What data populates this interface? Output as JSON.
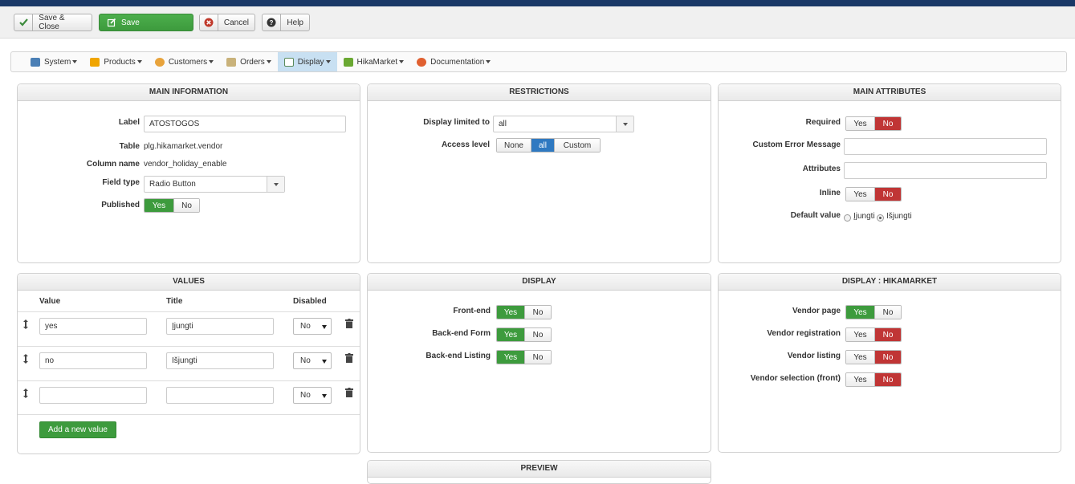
{
  "toolbar": {
    "save_close": "Save & Close",
    "save": "Save",
    "cancel": "Cancel",
    "help": "Help"
  },
  "menu": [
    {
      "label": "System",
      "icon": "wrench-icon"
    },
    {
      "label": "Products",
      "icon": "products-icon"
    },
    {
      "label": "Customers",
      "icon": "customers-icon"
    },
    {
      "label": "Orders",
      "icon": "orders-icon"
    },
    {
      "label": "Display",
      "icon": "display-icon",
      "active": true
    },
    {
      "label": "HikaMarket",
      "icon": "hikamarket-icon"
    },
    {
      "label": "Documentation",
      "icon": "lifebuoy-icon"
    }
  ],
  "main_info": {
    "title": "MAIN INFORMATION",
    "label_label": "Label",
    "label_value": "ATOSTOGOS",
    "table_label": "Table",
    "table_value": "plg.hikamarket.vendor",
    "column_label": "Column name",
    "column_value": "vendor_holiday_enable",
    "fieldtype_label": "Field type",
    "fieldtype_value": "Radio Button",
    "published_label": "Published",
    "yes": "Yes",
    "no": "No"
  },
  "restrictions": {
    "title": "RESTRICTIONS",
    "display_limited_label": "Display limited to",
    "display_limited_value": "all",
    "access_label": "Access level",
    "access_none": "None",
    "access_all": "all",
    "access_custom": "Custom"
  },
  "main_attributes": {
    "title": "MAIN ATTRIBUTES",
    "required_label": "Required",
    "custom_error_label": "Custom Error Message",
    "attributes_label": "Attributes",
    "inline_label": "Inline",
    "default_label": "Default value",
    "default_opt1": "Įjungti",
    "default_opt2": "Išjungti",
    "yes": "Yes",
    "no": "No"
  },
  "values": {
    "title": "VALUES",
    "col_value": "Value",
    "col_title": "Title",
    "col_disabled": "Disabled",
    "rows": [
      {
        "value": "yes",
        "title": "Įjungti",
        "disabled": "No"
      },
      {
        "value": "no",
        "title": "Išjungti",
        "disabled": "No"
      },
      {
        "value": "",
        "title": "",
        "disabled": "No"
      }
    ],
    "add_button": "Add a new value"
  },
  "display": {
    "title": "DISPLAY",
    "frontend_label": "Front-end",
    "backend_form_label": "Back-end Form",
    "backend_listing_label": "Back-end Listing",
    "yes": "Yes",
    "no": "No"
  },
  "display_hika": {
    "title": "DISPLAY : HIKAMARKET",
    "vendor_page_label": "Vendor page",
    "vendor_registration_label": "Vendor registration",
    "vendor_listing_label": "Vendor listing",
    "vendor_selection_label": "Vendor selection (front)",
    "yes": "Yes",
    "no": "No"
  },
  "preview": {
    "title": "PREVIEW"
  }
}
